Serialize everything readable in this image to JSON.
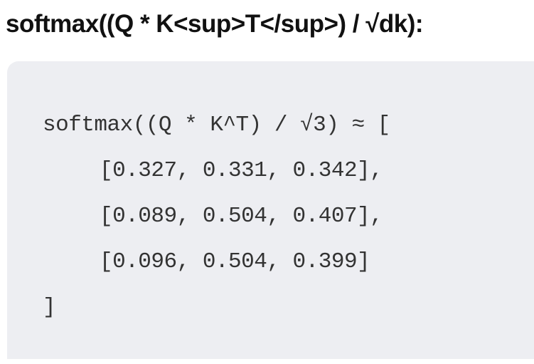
{
  "heading": "softmax((Q * K<sup>T</sup>) / √dk):",
  "code_lines": [
    "softmax((Q * K^T) / √3) ≈ [",
    "[0.327, 0.331, 0.342],",
    "[0.089, 0.504, 0.407],",
    "[0.096, 0.504, 0.399]",
    "]"
  ],
  "colors": {
    "code_background": "#edeef2",
    "text": "#333333"
  }
}
